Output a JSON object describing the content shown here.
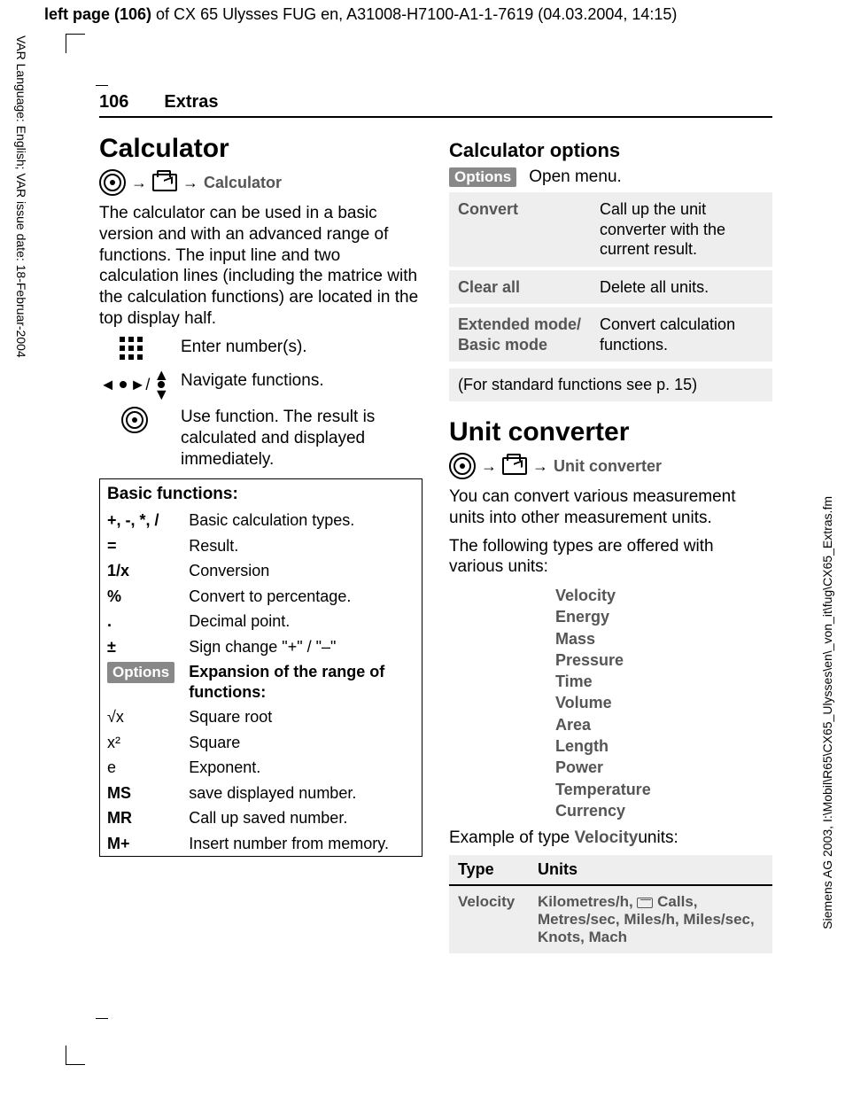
{
  "top_header_bold": "left page (106)",
  "top_header_rest": " of CX 65 Ulysses FUG en, A31008-H7100-A1-1-7619 (04.03.2004, 14:15)",
  "side_left": "VAR Language: English; VAR issue date: 18-Februar-2004",
  "side_right": "Siemens AG 2003, I:\\Mobil\\R65\\CX65_Ulysses\\en\\_von_it\\fug\\CX65_Extras.fm",
  "page_number": "106",
  "page_section": "Extras",
  "left": {
    "h1": "Calculator",
    "nav_label": "Calculator",
    "intro": "The calculator can be used in a basic version and with an advanced range of functions. The input line and two calculation lines (including the matrice with the calculation functions) are located in the top display half.",
    "rows": [
      {
        "icon": "keypad",
        "text": "Enter number(s)."
      },
      {
        "icon": "navpad",
        "text": "Navigate functions."
      },
      {
        "icon": "bullseye",
        "text": "Use function. The result is calculated and displayed immediately."
      }
    ],
    "box_title": "Basic functions:",
    "funcs": [
      {
        "k": "+, -, *, /",
        "v": "Basic calculation types."
      },
      {
        "k": "=",
        "v": "Result."
      },
      {
        "k": "1/x",
        "v": "Conversion"
      },
      {
        "k": "%",
        "v": "Convert to percentage."
      },
      {
        "k": ".",
        "v": "Decimal point."
      },
      {
        "k": "±",
        "v": "Sign change \"+\" / \"–\""
      }
    ],
    "options_badge": "Options",
    "expand_label": "Expansion of the range of functions:",
    "ext_funcs": [
      {
        "k": "√x",
        "v": "Square root"
      },
      {
        "k": "x²",
        "v": "Square"
      },
      {
        "k": "e",
        "v": "Exponent."
      },
      {
        "k": "MS",
        "v": "save displayed number."
      },
      {
        "k": "MR",
        "v": "Call up saved number."
      },
      {
        "k": "M+",
        "v": "Insert number from memory."
      }
    ]
  },
  "right": {
    "h2a": "Calculator options",
    "options_badge": "Options",
    "options_open": "Open menu.",
    "opts": [
      {
        "k": "Convert",
        "v": "Call up the unit converter with the current result."
      },
      {
        "k": "Clear all",
        "v": "Delete all units."
      },
      {
        "k": "Extended mode/ Basic mode",
        "v": "Convert calculation functions."
      }
    ],
    "opts_foot": "(For standard functions see p. 15)",
    "h1b": "Unit converter",
    "nav_label": "Unit converter",
    "uc_p1": "You can convert various measurement units into other measurement units.",
    "uc_p2": "The following types are offered with various units:",
    "unit_types": [
      "Velocity",
      "Energy",
      "Mass",
      "Pressure",
      "Time",
      "Volume",
      "Area",
      "Length",
      "Power",
      "Temperature",
      "Currency"
    ],
    "example_pre": "Example of type ",
    "example_type": "Velocity",
    "example_post": "units:",
    "vel_header_type": "Type",
    "vel_header_units": "Units",
    "vel_row_type": "Velocity",
    "vel_row_units_a": "Kilometres/h, ",
    "vel_row_units_b": " Calls, Metres/sec, Miles/h, Miles/sec, Knots, Mach"
  }
}
